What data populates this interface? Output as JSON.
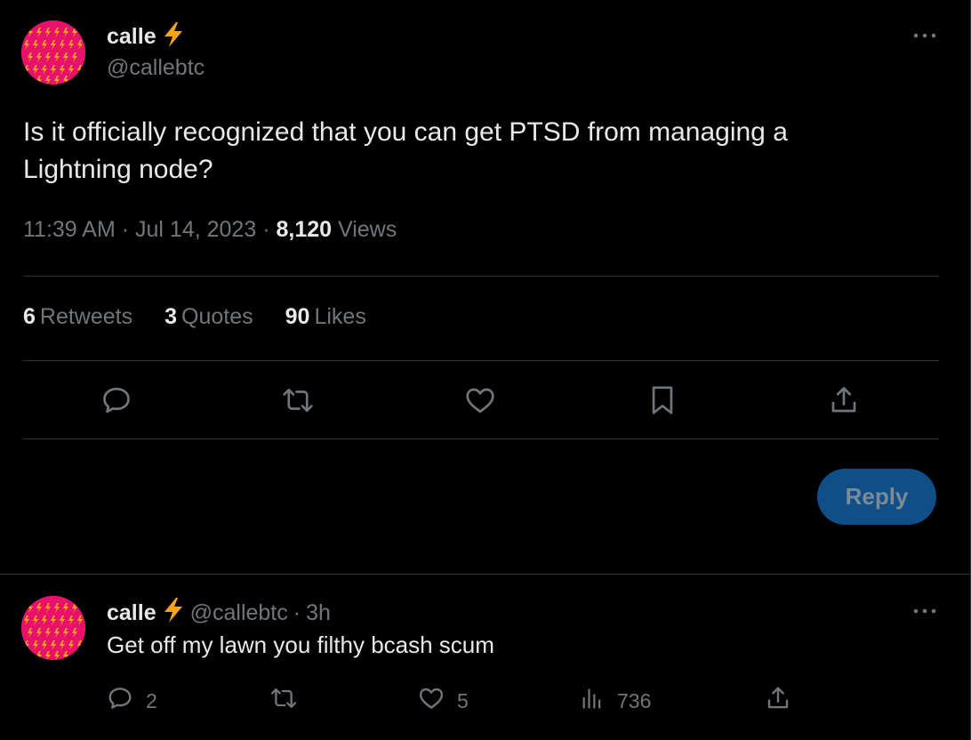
{
  "tweet": {
    "author": {
      "display_name": "calle",
      "name_emoji": "⚡",
      "handle": "@callebtc",
      "avatar_icon": "lightning-pattern-avatar"
    },
    "text": "Is it officially recognized that you can get PTSD from managing a Lightning node?",
    "time": "11:39 AM",
    "date": "Jul 14, 2023",
    "views_count": "8,120",
    "views_label": "Views",
    "dot": "·",
    "stats": {
      "retweets_count": "6",
      "retweets_label": "Retweets",
      "quotes_count": "3",
      "quotes_label": "Quotes",
      "likes_count": "90",
      "likes_label": "Likes"
    },
    "actions": [
      "reply-icon",
      "retweet-icon",
      "like-icon",
      "bookmark-icon",
      "share-icon"
    ],
    "more_icon": "more-dots-icon"
  },
  "composer": {
    "reply_button_label": "Reply"
  },
  "reply": {
    "author": {
      "display_name": "calle",
      "name_emoji": "⚡",
      "handle": "@callebtc",
      "separator": "·",
      "age": "3h"
    },
    "text": "Get off my lawn you filthy bcash scum",
    "counts": {
      "replies": "2",
      "likes": "5",
      "views": "736"
    }
  },
  "colors": {
    "background": "#000000",
    "text_primary": "#e7e9ea",
    "text_secondary": "#71767b",
    "divider": "#2f3336",
    "reply_button": "#0f4e86",
    "avatar_bg": "#e8126b",
    "bolt": "#f7a41d"
  }
}
